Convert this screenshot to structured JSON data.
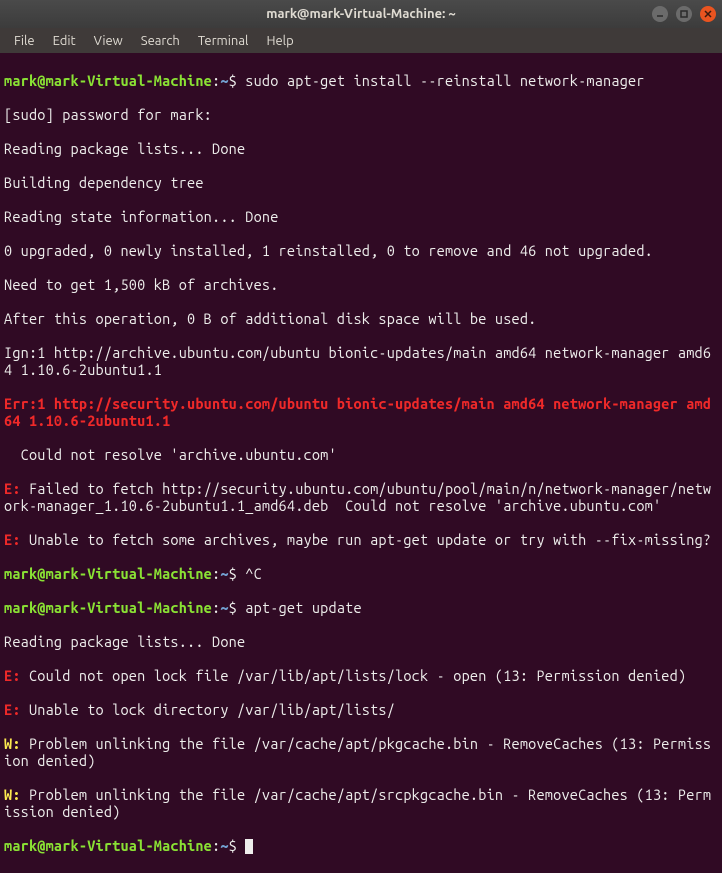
{
  "window": {
    "title": "mark@mark-Virtual-Machine: ~"
  },
  "menu": {
    "file": "File",
    "edit": "Edit",
    "view": "View",
    "search": "Search",
    "terminal": "Terminal",
    "help": "Help"
  },
  "t": {
    "prompt": "mark@mark-Virtual-Machine",
    "colon": ":",
    "tilde": "~",
    "dollar": "$ ",
    "cmd1": "sudo apt-get install --reinstall network-manager",
    "l2": "[sudo] password for mark:",
    "l3": "Reading package lists... Done",
    "l4": "Building dependency tree",
    "l5": "Reading state information... Done",
    "l6": "0 upgraded, 0 newly installed, 1 reinstalled, 0 to remove and 46 not upgraded.",
    "l7": "Need to get 1,500 kB of archives.",
    "l8": "After this operation, 0 B of additional disk space will be used.",
    "l9": "Ign:1 http://archive.ubuntu.com/ubuntu bionic-updates/main amd64 network-manager amd64 1.10.6-2ubuntu1.1",
    "err1a": "Err:1 http://security.ubuntu.com/ubuntu bionic-updates/main amd64 network-manager amd64 1.10.6-2ubuntu1.1",
    "err1b": "  Could not resolve 'archive.ubuntu.com'",
    "e1p": "E: ",
    "e1": "Failed to fetch http://security.ubuntu.com/ubuntu/pool/main/n/network-manager/network-manager_1.10.6-2ubuntu1.1_amd64.deb  Could not resolve 'archive.ubuntu.com'",
    "e2p": "E: ",
    "e2": "Unable to fetch some archives, maybe run apt-get update or try with --fix-missing?",
    "cmd2": "^C",
    "cmd3": "apt-get update",
    "l10": "Reading package lists... Done",
    "e3p": "E: ",
    "e3": "Could not open lock file /var/lib/apt/lists/lock - open (13: Permission denied)",
    "e4p": "E: ",
    "e4": "Unable to lock directory /var/lib/apt/lists/",
    "w1p": "W: ",
    "w1": "Problem unlinking the file /var/cache/apt/pkgcache.bin - RemoveCaches (13: Permission denied)",
    "w2p": "W: ",
    "w2": "Problem unlinking the file /var/cache/apt/srcpkgcache.bin - RemoveCaches (13: Permission denied)"
  }
}
